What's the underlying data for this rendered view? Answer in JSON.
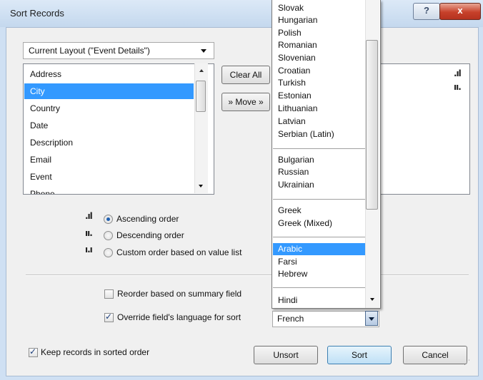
{
  "window": {
    "title": "Sort Records",
    "help_label": "?",
    "close_label": "x"
  },
  "layout_combo": {
    "value": "Current Layout (\"Event Details\")"
  },
  "fields": [
    "Address",
    "City",
    "Country",
    "Date",
    "Description",
    "Email",
    "Event",
    "Phone"
  ],
  "selected_field": "City",
  "buttons": {
    "clear_all": "Clear All",
    "move": "» Move »",
    "unsort": "Unsort",
    "sort": "Sort",
    "cancel": "Cancel"
  },
  "sort_icons": {
    "ascending": ".ıl",
    "descending": "ıı.",
    "custom": "ı.ı"
  },
  "order_options": [
    {
      "label": "Ascending order",
      "selected": true
    },
    {
      "label": "Descending order",
      "selected": false
    },
    {
      "label": "Custom order based on value list",
      "selected": false
    }
  ],
  "checkboxes": {
    "reorder_summary": {
      "label": "Reorder based on summary field",
      "checked": false
    },
    "override_language": {
      "label": "Override field's language for sort",
      "checked": true
    },
    "keep_sorted": {
      "label": "Keep records in sorted order",
      "checked": true
    }
  },
  "language_combo": {
    "value": "French"
  },
  "language_options": [
    [
      "Slovak",
      "Hungarian",
      "Polish",
      "Romanian",
      "Slovenian",
      "Croatian",
      "Turkish",
      "Estonian",
      "Lithuanian",
      "Latvian",
      "Serbian (Latin)"
    ],
    [
      "Bulgarian",
      "Russian",
      "Ukrainian"
    ],
    [
      "Greek",
      "Greek (Mixed)"
    ],
    [
      "Arabic",
      "Farsi",
      "Hebrew"
    ],
    [
      "Hindi"
    ]
  ],
  "selected_language": "Arabic"
}
